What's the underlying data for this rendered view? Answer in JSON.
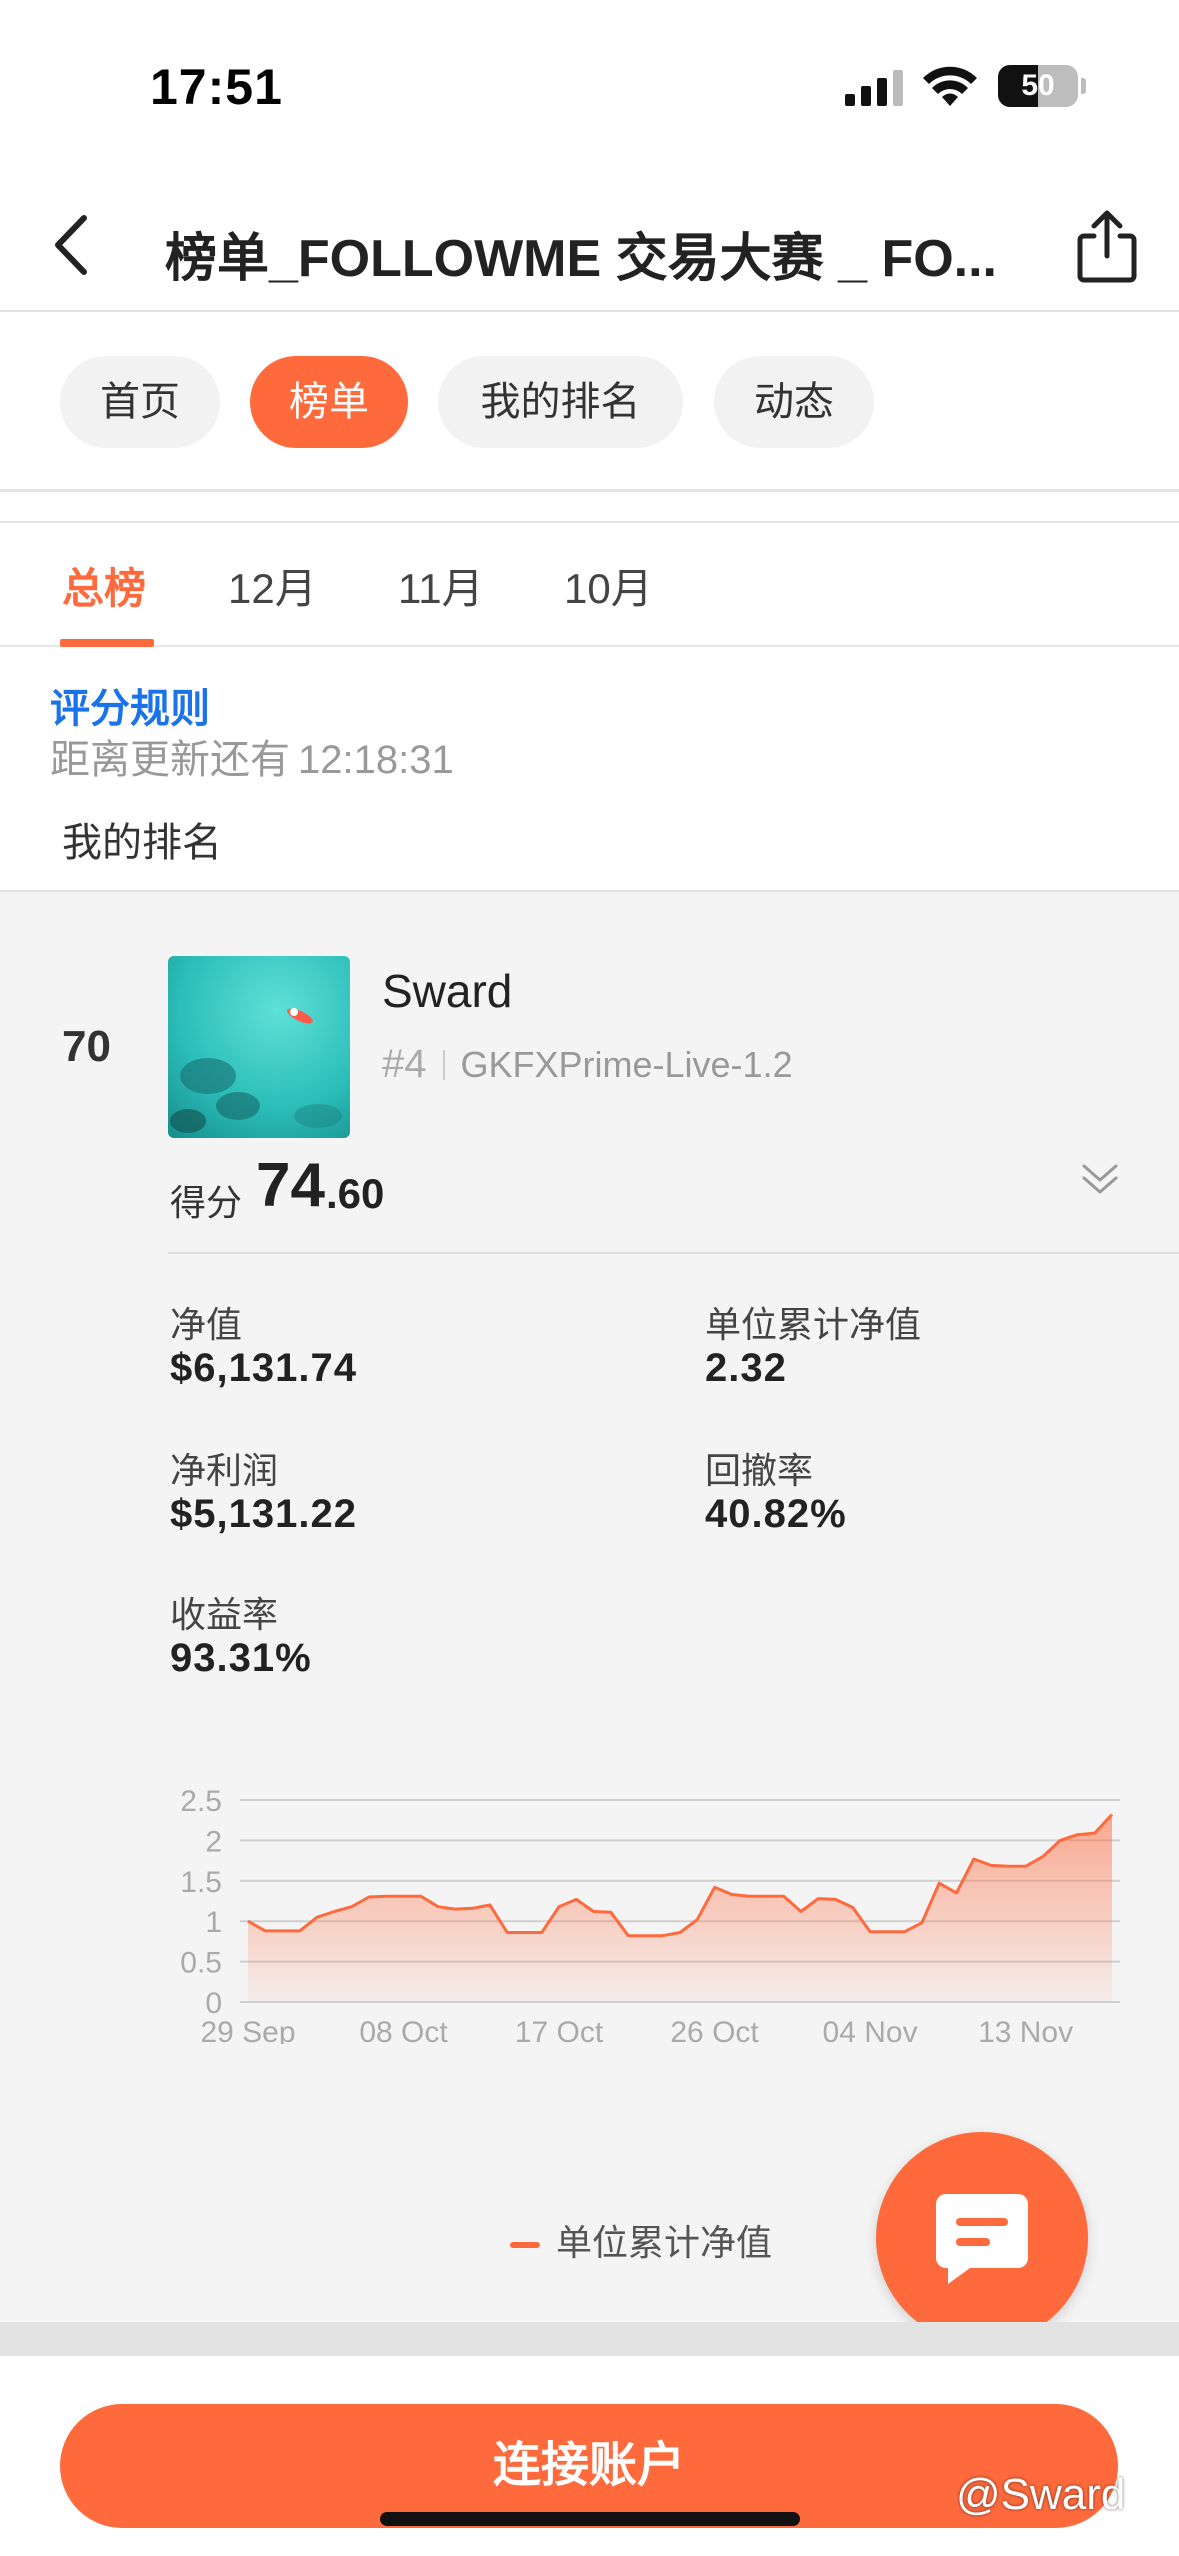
{
  "status_bar": {
    "time": "17:51",
    "battery": "50",
    "battery_level": 0.5
  },
  "nav": {
    "title": "榜单_FOLLOWME 交易大赛 _ FO..."
  },
  "pills": [
    "首页",
    "榜单",
    "我的排名",
    "动态"
  ],
  "month_tabs": [
    "总榜",
    "12月",
    "11月",
    "10月"
  ],
  "rules_link": "评分规则",
  "countdown": {
    "label": "距离更新还有",
    "value": "12:18:31"
  },
  "my_rank_label": "我的排名",
  "card": {
    "rank": "70",
    "name": "Sward",
    "rank_tag": "#4",
    "server": "GKFXPrime-Live-1.2",
    "score_label": "得分",
    "score_int": "74",
    "score_dec": ".60",
    "stats": {
      "equity_label": "净值",
      "equity": "$6,131.74",
      "unit_nav_label": "单位累计净值",
      "unit_nav": "2.32",
      "net_profit_label": "净利润",
      "net_profit": "$5,131.22",
      "drawdown_label": "回撤率",
      "drawdown": "40.82%",
      "return_label": "收益率",
      "return": "93.31%"
    }
  },
  "chart_data": {
    "type": "area",
    "x_ticks": [
      "29 Sep",
      "08 Oct",
      "17 Oct",
      "26 Oct",
      "04 Nov",
      "13 Nov"
    ],
    "y_ticks": [
      "0",
      "0.5",
      "1",
      "1.5",
      "2",
      "2.5"
    ],
    "ylim": [
      0,
      2.5
    ],
    "grid": true,
    "legend_position": "bottom",
    "series": [
      {
        "name": "单位累计净值",
        "color": "#ff6a3d",
        "x": [
          "29 Sep",
          "30 Sep",
          "01 Oct",
          "02 Oct",
          "03 Oct",
          "04 Oct",
          "05 Oct",
          "06 Oct",
          "07 Oct",
          "08 Oct",
          "09 Oct",
          "10 Oct",
          "11 Oct",
          "12 Oct",
          "13 Oct",
          "14 Oct",
          "15 Oct",
          "16 Oct",
          "17 Oct",
          "18 Oct",
          "19 Oct",
          "20 Oct",
          "21 Oct",
          "22 Oct",
          "23 Oct",
          "24 Oct",
          "25 Oct",
          "26 Oct",
          "27 Oct",
          "28 Oct",
          "29 Oct",
          "30 Oct",
          "31 Oct",
          "01 Nov",
          "02 Nov",
          "03 Nov",
          "04 Nov",
          "05 Nov",
          "06 Nov",
          "07 Nov",
          "08 Nov",
          "09 Nov",
          "10 Nov",
          "11 Nov",
          "12 Nov",
          "13 Nov",
          "14 Nov",
          "15 Nov",
          "16 Nov",
          "17 Nov",
          "18 Nov"
        ],
        "values": [
          1.0,
          0.88,
          0.88,
          0.88,
          1.05,
          1.12,
          1.18,
          1.3,
          1.31,
          1.31,
          1.31,
          1.18,
          1.15,
          1.16,
          1.2,
          0.86,
          0.86,
          0.86,
          1.18,
          1.27,
          1.12,
          1.11,
          0.82,
          0.82,
          0.82,
          0.86,
          1.02,
          1.42,
          1.33,
          1.31,
          1.31,
          1.31,
          1.12,
          1.28,
          1.27,
          1.17,
          0.87,
          0.87,
          0.87,
          0.98,
          1.47,
          1.35,
          1.77,
          1.69,
          1.68,
          1.68,
          1.8,
          2.0,
          2.07,
          2.09,
          2.32
        ]
      }
    ]
  },
  "chat_button": "chat",
  "connect_button": "连接账户",
  "watermark": "@Sward"
}
